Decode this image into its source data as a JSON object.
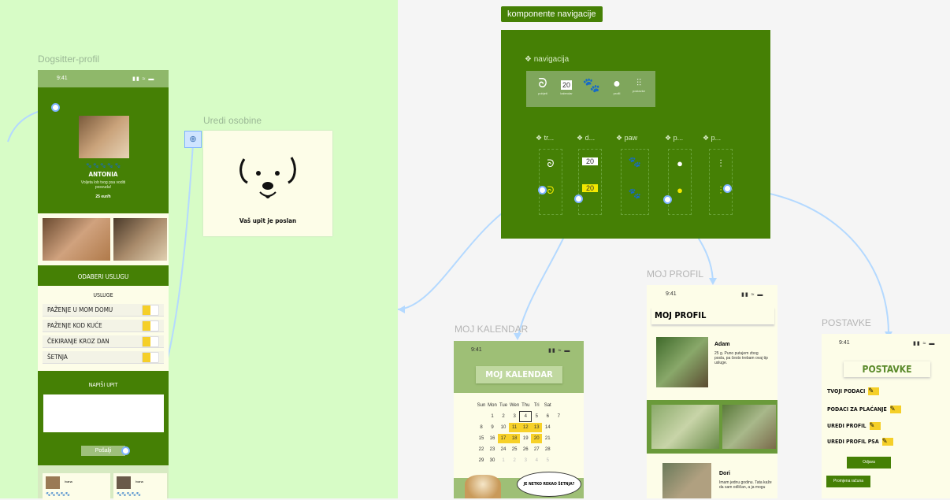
{
  "frames": {
    "dogsitter": "Dogsitter-profil",
    "uredi": "Uredi osobine",
    "nav_components": "komponente navigacije",
    "moj_kalendar": "MOJ KALENDAR",
    "moj_profil": "MOJ PROFIL",
    "postavke": "POSTAVKE"
  },
  "phone_status_time": "9:41",
  "dogsitter": {
    "paws": "🐾 🐾 🐾 🐾 🐾",
    "name": "ANTONIA",
    "tagline": "Voljeta lob tvog psa voditi posvuda!",
    "price": "25 eur/h",
    "odaberi_uslugu": "ODABERI USLUGU",
    "usluge_heading": "USLUGE",
    "services": [
      "PAŽENJE U MOM DOMU",
      "PAŽENJE KOD KUĆE",
      "ČEKIRANJE KROZ DAN",
      "ŠETNJA"
    ],
    "napisi_upit": "NAPIŠI UPIT",
    "posalji": "Pošalji",
    "reviews": [
      {
        "name": "Ivana",
        "rating": "🐾🐾🐾🐾🐾"
      },
      {
        "name": "Ivana",
        "rating": "🐾🐾🐾🐾🐾"
      }
    ]
  },
  "uredi": {
    "message": "Vaš upit je poslan"
  },
  "navigation": {
    "title": "❖ navigacija",
    "items": [
      {
        "icon": "leash-icon",
        "glyph": "ᘐ",
        "label": "pobjeti"
      },
      {
        "icon": "calendar-icon",
        "glyph": "20",
        "label": "kalendar"
      },
      {
        "icon": "paw-icon",
        "glyph": "🐾",
        "label": ""
      },
      {
        "icon": "profile-icon",
        "glyph": "●",
        "label": "profil"
      },
      {
        "icon": "settings-icon",
        "glyph": "⫶⫶",
        "label": "postavke"
      }
    ],
    "component_headers": [
      "❖ tr...",
      "❖ d...",
      "❖ paw",
      "❖ p...",
      "❖ p..."
    ]
  },
  "calendar": {
    "title": "MOJ KALENDAR",
    "weekdays": [
      "Sun",
      "Mon",
      "Tue",
      "Wen",
      "Thu",
      "Tri",
      "Sat"
    ],
    "weeks": [
      [
        "",
        "1",
        "2",
        "3",
        "4",
        "5",
        "6",
        "7"
      ],
      [
        "8",
        "9",
        "10",
        "11",
        "12",
        "13",
        "14"
      ],
      [
        "15",
        "16",
        "17",
        "18",
        "19",
        "20",
        "21"
      ],
      [
        "22",
        "23",
        "24",
        "25",
        "26",
        "27",
        "28"
      ],
      [
        "29",
        "30",
        "1",
        "2",
        "3",
        "4",
        "5"
      ]
    ],
    "speech": "JE NETKO REKAO ŠETNJA?"
  },
  "profile": {
    "title": "MOJ PROFIL",
    "person1_name": "Adam",
    "person1_text": "25 g. Puno putujem zbog posla, pa često trebam ovaj tip usluge.",
    "person2_name": "Dori",
    "person2_text": "Imam jednu godinu. Tata kaže da sam odličan, a ja mogu"
  },
  "settings": {
    "title": "POSTAVKE",
    "rows": [
      "TVOJI PODACI",
      "PODACI ZA PLAĆANJE",
      "UREDI PROFIL",
      "UREDI PROFIL PSA"
    ],
    "odjava": "Odjava",
    "promjena": "Promjena računa"
  },
  "colors": {
    "canvas_green": "#d7fcc6",
    "brand_green": "#458005",
    "cream": "#fdfde8",
    "accent_yellow": "#f5cf28",
    "connector_blue": "#b4d9ff"
  }
}
